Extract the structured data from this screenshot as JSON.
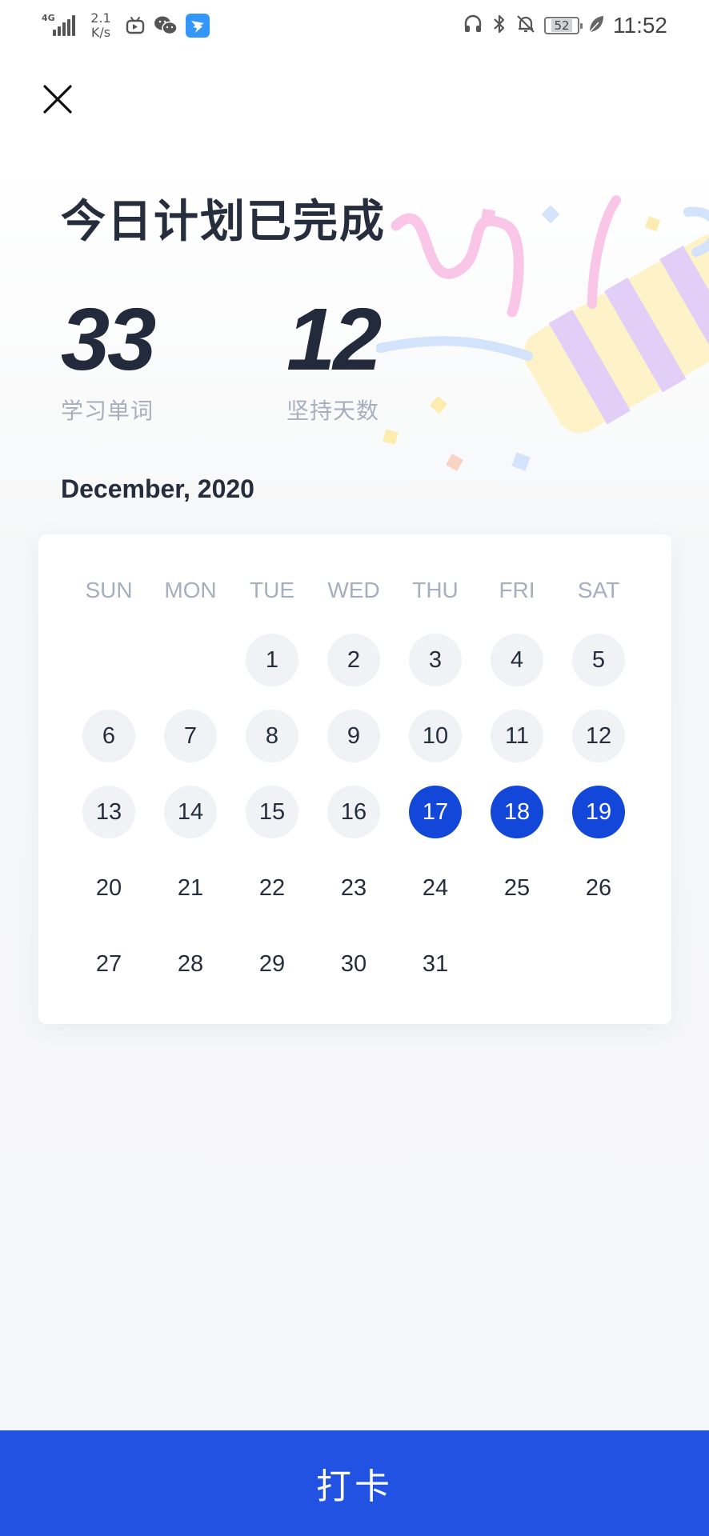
{
  "status_bar": {
    "network": "4G",
    "net_speed_value": "2.1",
    "net_speed_unit": "K/s",
    "battery": "52",
    "time": "11:52",
    "left_icons": [
      "bilibili-tv-icon",
      "wechat-icon",
      "dingtalk-icon"
    ],
    "right_icons": [
      "headphones-icon",
      "bluetooth-icon",
      "bell-off-icon",
      "battery-icon",
      "leaf-icon"
    ]
  },
  "header": {
    "title": "今日计划已完成",
    "stats": [
      {
        "value": "33",
        "label": "学习单词"
      },
      {
        "value": "12",
        "label": "坚持天数"
      }
    ],
    "month": "December, 2020"
  },
  "calendar": {
    "weekdays": [
      "SUN",
      "MON",
      "TUE",
      "WED",
      "THU",
      "FRI",
      "SAT"
    ],
    "first_weekday_index": 2,
    "days_in_month": 31,
    "checked_in_days": [
      1,
      2,
      3,
      4,
      5,
      6,
      7,
      8,
      9,
      10,
      11,
      12,
      13,
      14,
      15,
      16
    ],
    "highlighted_days": [
      17,
      18,
      19
    ],
    "colors": {
      "done": "#f0f2f6",
      "highlight": "#1347d9"
    }
  },
  "action": {
    "checkin_label": "打卡",
    "color": "#2152e1"
  }
}
